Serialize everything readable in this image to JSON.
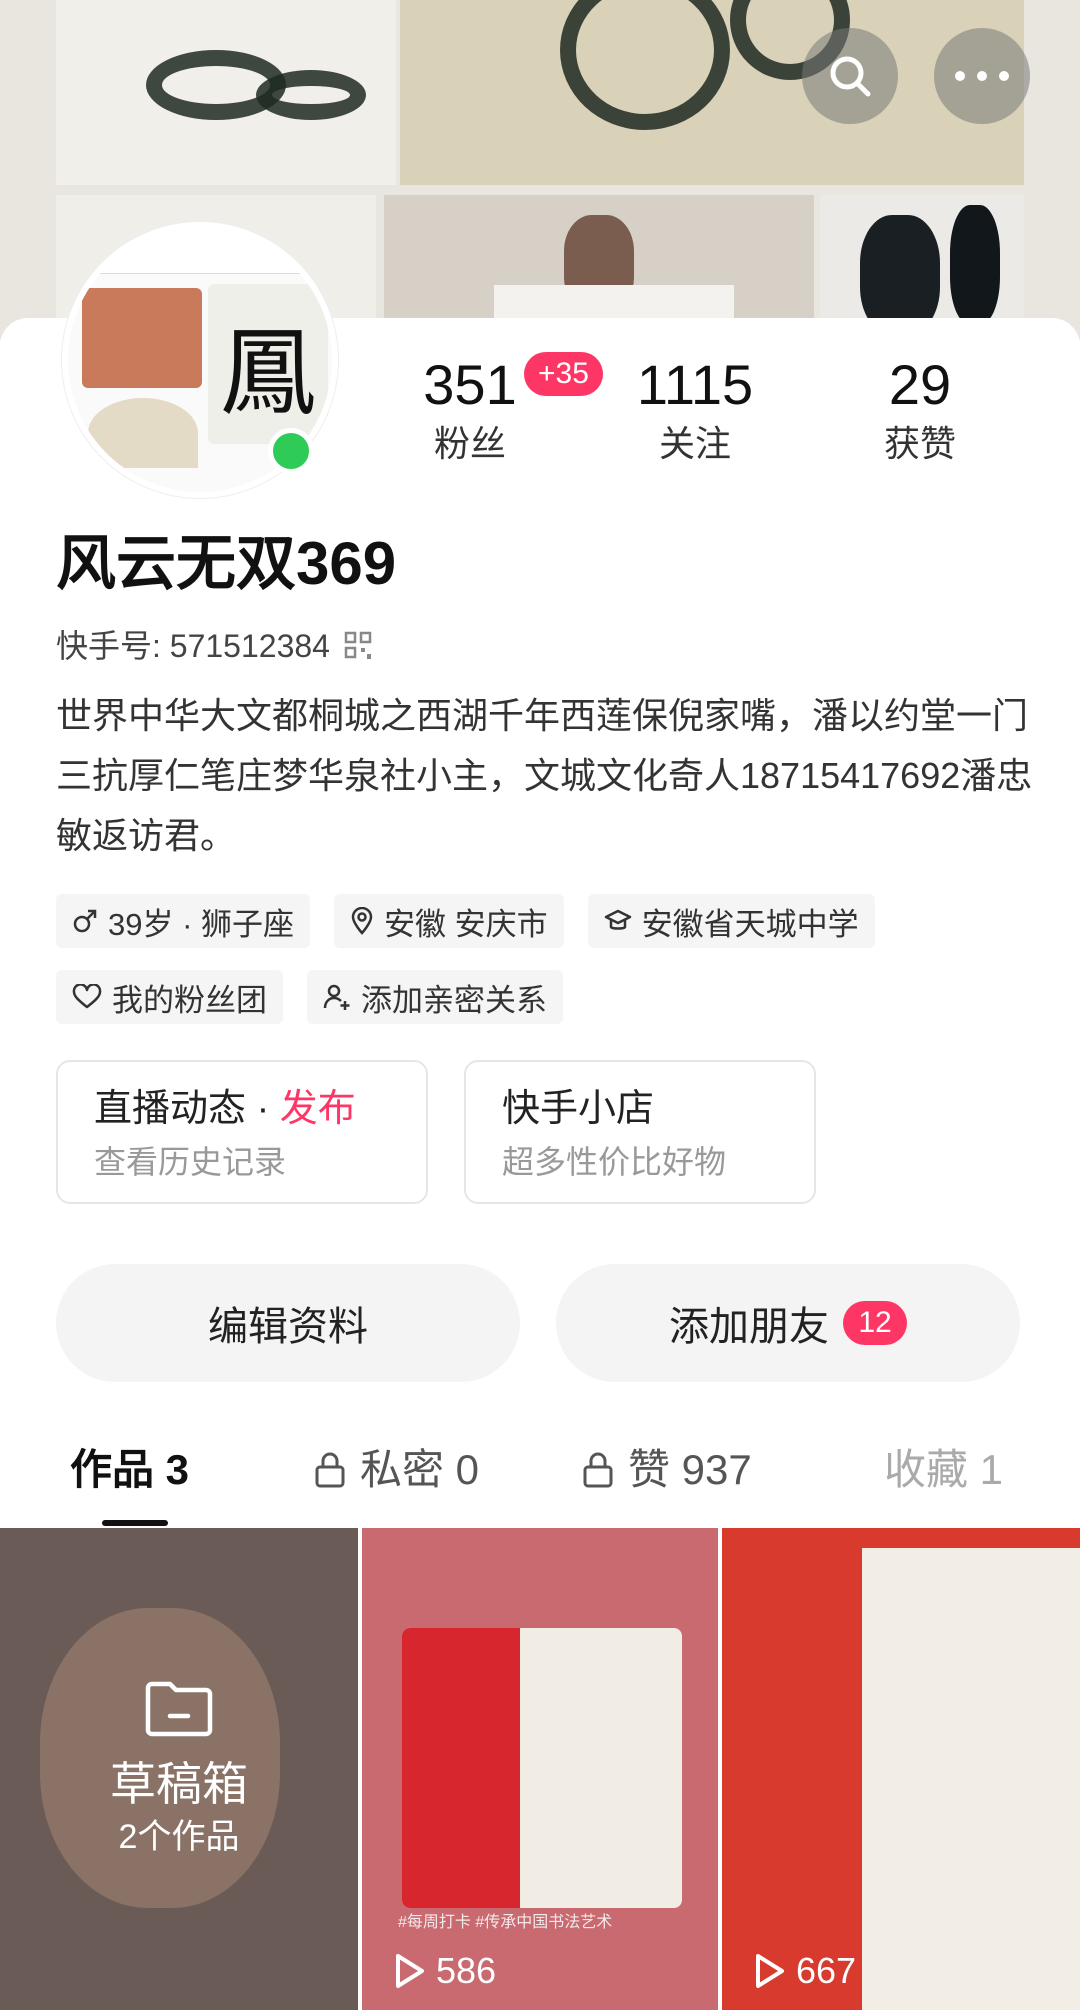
{
  "header": {
    "search_icon": "search-icon",
    "more_icon": "more-dots-icon"
  },
  "stats": {
    "fans": {
      "value": "351",
      "label": "粉丝",
      "delta": "+35"
    },
    "following": {
      "value": "1115",
      "label": "关注"
    },
    "likes": {
      "value": "29",
      "label": "获赞"
    }
  },
  "profile": {
    "name": "风云无双369",
    "kuaishou_id_label": "快手号: 571512384",
    "bio": "世界中华大文都桐城之西湖千年西莲保倪家嘴，潘以约堂一门三抗厚仁笔庄梦华泉社小主，文城文化奇人18715417692潘忠敏返访君。"
  },
  "tags": {
    "row1": [
      "39岁 · 狮子座",
      "安徽 安庆市",
      "安徽省天城中学"
    ],
    "row2": [
      "我的粉丝团",
      "添加亲密关系"
    ]
  },
  "cards": {
    "live": {
      "title": "直播动态",
      "dot": " · ",
      "action": "发布",
      "sub": "查看历史记录"
    },
    "shop": {
      "title": "快手小店",
      "sub": "超多性价比好物"
    }
  },
  "actions": {
    "edit": "编辑资料",
    "add_friend": "添加朋友",
    "add_friend_count": "12"
  },
  "tabs": [
    {
      "label": "作品 3"
    },
    {
      "label": "私密 0"
    },
    {
      "label": "赞 937"
    },
    {
      "label": "收藏 1"
    }
  ],
  "grid": {
    "draft": {
      "title": "草稿箱",
      "count": "2个作品"
    },
    "video2": {
      "plays": "586",
      "hashtags": "#每周打卡 #传承中国书法艺术"
    },
    "video3": {
      "plays": "667"
    }
  },
  "colors": {
    "accent": "#fe3666",
    "online": "#2ecc57"
  }
}
